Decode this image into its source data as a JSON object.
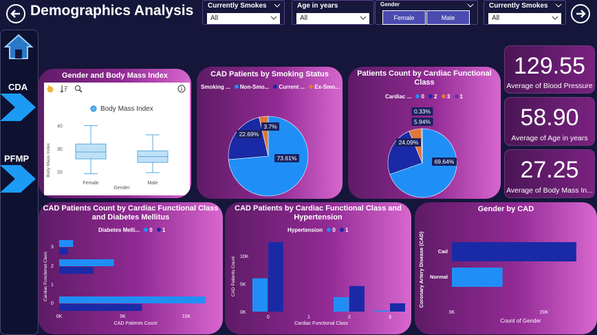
{
  "header": {
    "title": "Demographics Analysis"
  },
  "slicers": {
    "smokes1": {
      "label": "Currently Smokes",
      "value": "All"
    },
    "age": {
      "label": "Age in years",
      "value": "All"
    },
    "gender": {
      "label": "Gender",
      "options": [
        "Female",
        "Male"
      ]
    },
    "smokes2": {
      "label": "Currently Smokes",
      "value": "All"
    }
  },
  "sidebar": {
    "items": [
      {
        "label": "CDA"
      },
      {
        "label": "PFMP"
      }
    ]
  },
  "colors": {
    "light_blue": "#1f8ff7",
    "dark_blue": "#1a2aa6",
    "orange": "#e0773c",
    "purple": "#6b2fa1"
  },
  "kpis": [
    {
      "value": "129.55",
      "caption": "Average of Blood Pressure"
    },
    {
      "value": "58.90",
      "caption": "Average of Age in years"
    },
    {
      "value": "27.25",
      "caption": "Average of Body Mass In..."
    }
  ],
  "boxplot_card": {
    "title": "Gender and Body Mass Index",
    "legend": "Body Mass Index",
    "ylabel": "Body Mass Index",
    "xlabel": "Gender",
    "yticks": [
      "40",
      "30",
      "20"
    ]
  },
  "smoking_card": {
    "title": "CAD Patients by Smoking Status",
    "legend_title": "Smoking ...",
    "legend_items": [
      "Non-Smo...",
      "Current ...",
      "Ex-Smo..."
    ]
  },
  "cardiac_card": {
    "title": "Patients Count by Cardiac Functional Class",
    "legend_title": "Cardiac ...",
    "legend_items": [
      "0",
      "2",
      "3",
      "1"
    ]
  },
  "diabetes_card": {
    "title": "CAD Patients Count by Cardiac Functional Class and Diabetes Mellitus",
    "legend_title": "Diabetes Melli...",
    "legend_items": [
      "0",
      "1"
    ],
    "ylabel": "Cardiac Functional Class",
    "xlabel": "CAD Patients Count"
  },
  "hypertension_card": {
    "title": "CAD Patients by Cardiac Functional Class and Hypertension",
    "legend_title": "Hypertension",
    "legend_items": [
      "0",
      "1"
    ],
    "ylabel": "CAD Patients Count",
    "xlabel": "Cardiac Functional Class"
  },
  "gender_cad_card": {
    "title": "Gender by CAD",
    "ylabel": "Coronary Artery Disease (CAD)",
    "xlabel": "Count of Gender"
  },
  "chart_data": [
    {
      "type": "box",
      "title": "Gender and Body Mass Index",
      "categories": [
        "Female",
        "Male"
      ],
      "ylim": [
        15,
        42
      ],
      "series": [
        {
          "name": "Female",
          "min": 19,
          "q1": 25.5,
          "median": 28.5,
          "q3": 32,
          "max": 40
        },
        {
          "name": "Male",
          "min": 19.5,
          "q1": 24,
          "median": 26.5,
          "q3": 29,
          "max": 36
        }
      ],
      "yticks": [
        40,
        30,
        20
      ]
    },
    {
      "type": "pie",
      "title": "CAD Patients by Smoking Status",
      "labels": [
        "Non-Smo...",
        "Current ...",
        "Ex-Smo..."
      ],
      "values": [
        73.61,
        22.69,
        3.7
      ],
      "data_labels": [
        "73.61%",
        "22.69%",
        "3.7%"
      ]
    },
    {
      "type": "pie",
      "title": "Patients Count by Cardiac Functional Class",
      "labels": [
        "0",
        "2",
        "3",
        "1"
      ],
      "values": [
        69.64,
        24.09,
        5.94,
        0.33
      ],
      "data_labels": [
        "69.64%",
        "24.09%",
        "5.94%",
        "0.33%"
      ]
    },
    {
      "type": "bar",
      "orientation": "horizontal",
      "title": "CAD Patients Count by Cardiac Functional Class and Diabetes Mellitus",
      "categories": [
        "3",
        "2",
        "1",
        "0"
      ],
      "series": [
        {
          "name": "0",
          "values": [
            1100,
            4300,
            0,
            11500
          ]
        },
        {
          "name": "1",
          "values": [
            700,
            2700,
            0,
            6500
          ]
        }
      ],
      "xlim": [
        0,
        12000
      ],
      "xticks": [
        "0K",
        "5K",
        "10K"
      ]
    },
    {
      "type": "bar",
      "title": "CAD Patients by Cardiac Functional Class and Hypertension",
      "categories": [
        "0",
        "1",
        "2",
        "3"
      ],
      "series": [
        {
          "name": "0",
          "values": [
            6000,
            0,
            2600,
            200
          ]
        },
        {
          "name": "1",
          "values": [
            12500,
            0,
            4600,
            1500
          ]
        }
      ],
      "ylim": [
        0,
        13000
      ],
      "yticks": [
        "10K",
        "5K",
        "0K"
      ]
    },
    {
      "type": "bar",
      "orientation": "horizontal",
      "title": "Gender by CAD",
      "categories": [
        "Cad",
        "Normal"
      ],
      "values": [
        27000,
        11000
      ],
      "xlim": [
        0,
        30000
      ],
      "xticks": [
        "0K",
        "20K"
      ]
    }
  ]
}
